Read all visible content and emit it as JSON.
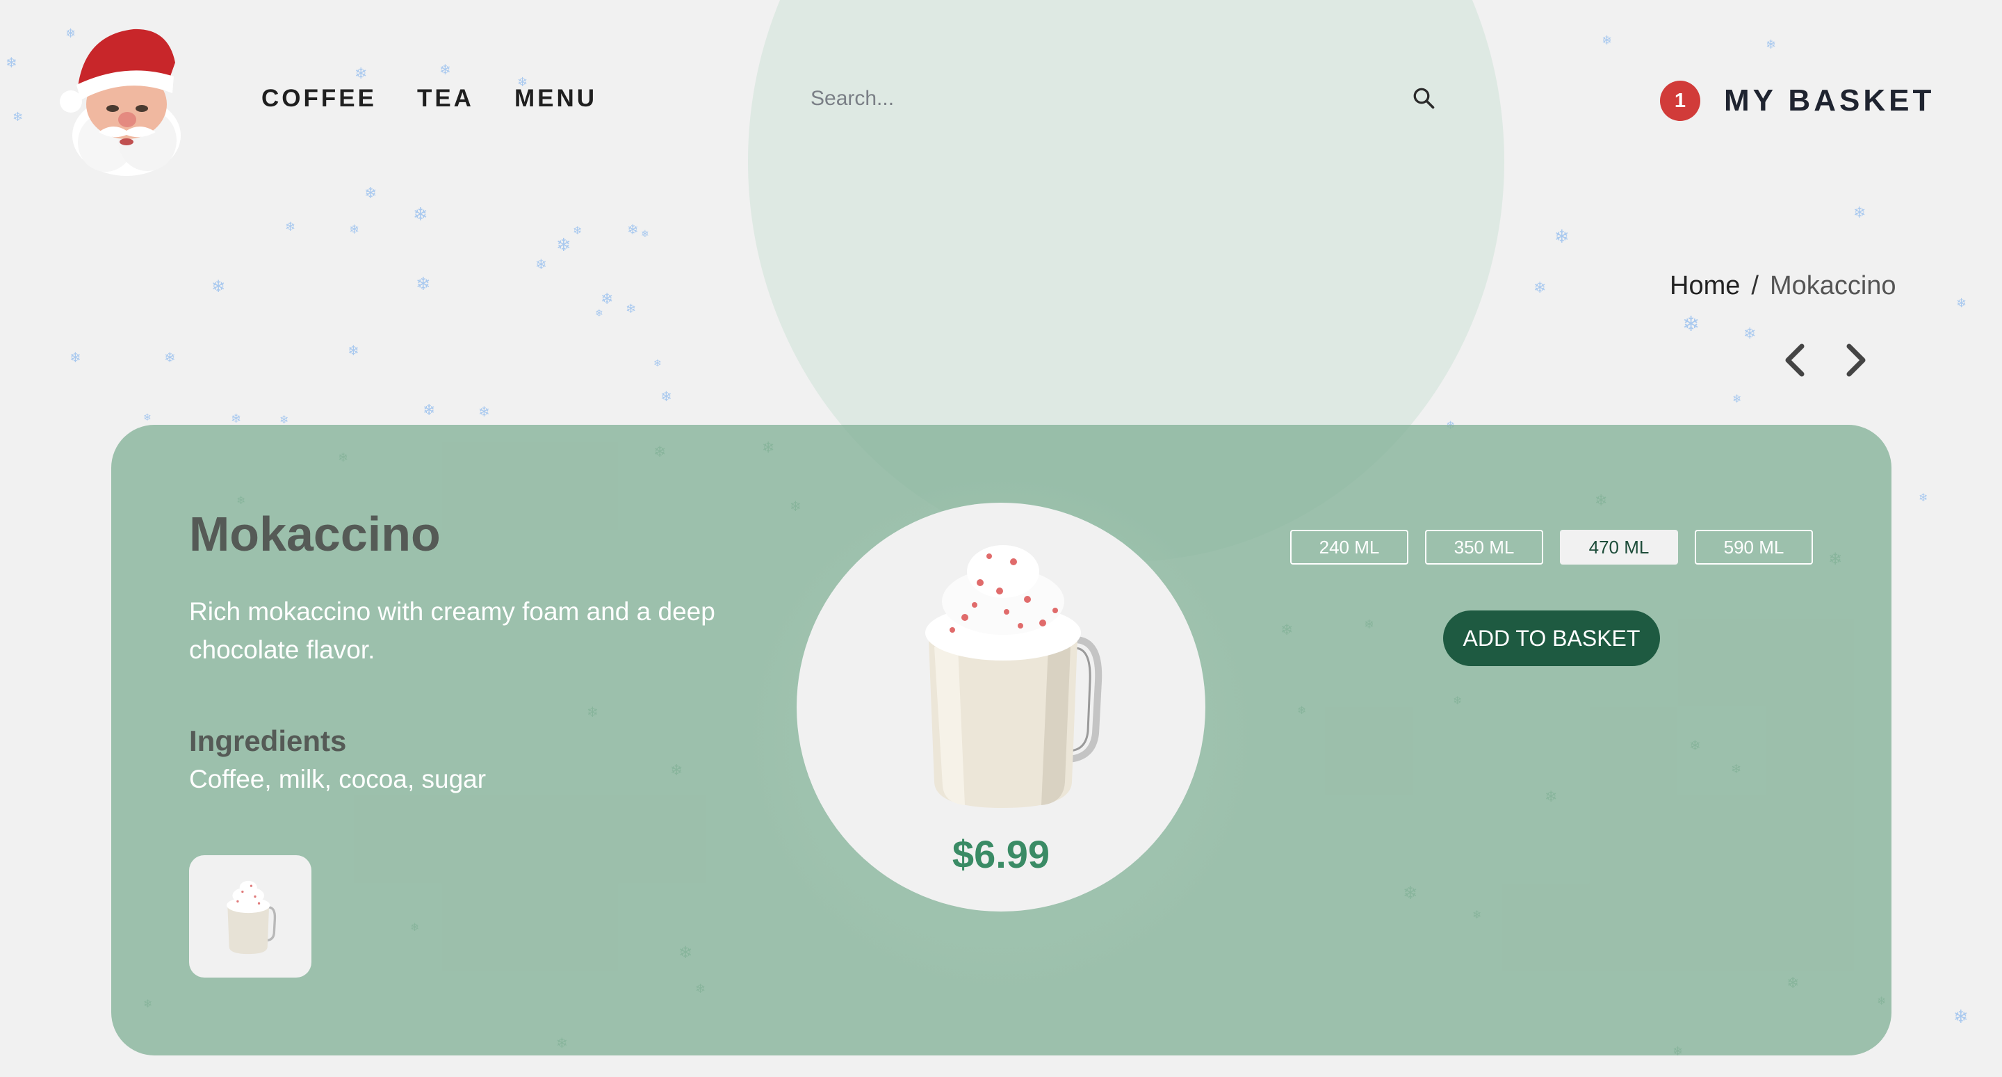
{
  "header": {
    "logo_icon": "santa-claus-head-icon",
    "nav": [
      {
        "label": "COFFEE"
      },
      {
        "label": "TEA"
      },
      {
        "label": "MENU"
      }
    ],
    "search": {
      "placeholder": "Search...",
      "value": "",
      "icon": "search-icon"
    },
    "basket": {
      "count": "1",
      "label": "MY BASKET"
    }
  },
  "breadcrumb": {
    "home": "Home",
    "separator": "/",
    "current": "Mokaccino"
  },
  "pager": {
    "prev_icon": "chevron-left-icon",
    "next_icon": "chevron-right-icon"
  },
  "product": {
    "name": "Mokaccino",
    "description": "Rich mokaccino with creamy foam and a deep chocolate flavor.",
    "ingredients_title": "Ingredients",
    "ingredients": "Coffee, milk, cocoa, sugar",
    "price": "$6.99",
    "sizes": [
      {
        "label": "240 ML",
        "selected": false
      },
      {
        "label": "350 ML",
        "selected": false
      },
      {
        "label": "470 ML",
        "selected": true
      },
      {
        "label": "590 ML",
        "selected": false
      }
    ],
    "add_label": "ADD TO BASKET"
  },
  "colors": {
    "background": "#f1f1f1",
    "card": "#9bbfa9",
    "accent": "#1e5a41",
    "price": "#3a8b65",
    "badge": "#d13b39",
    "snowflake": "#a9c9ef"
  }
}
